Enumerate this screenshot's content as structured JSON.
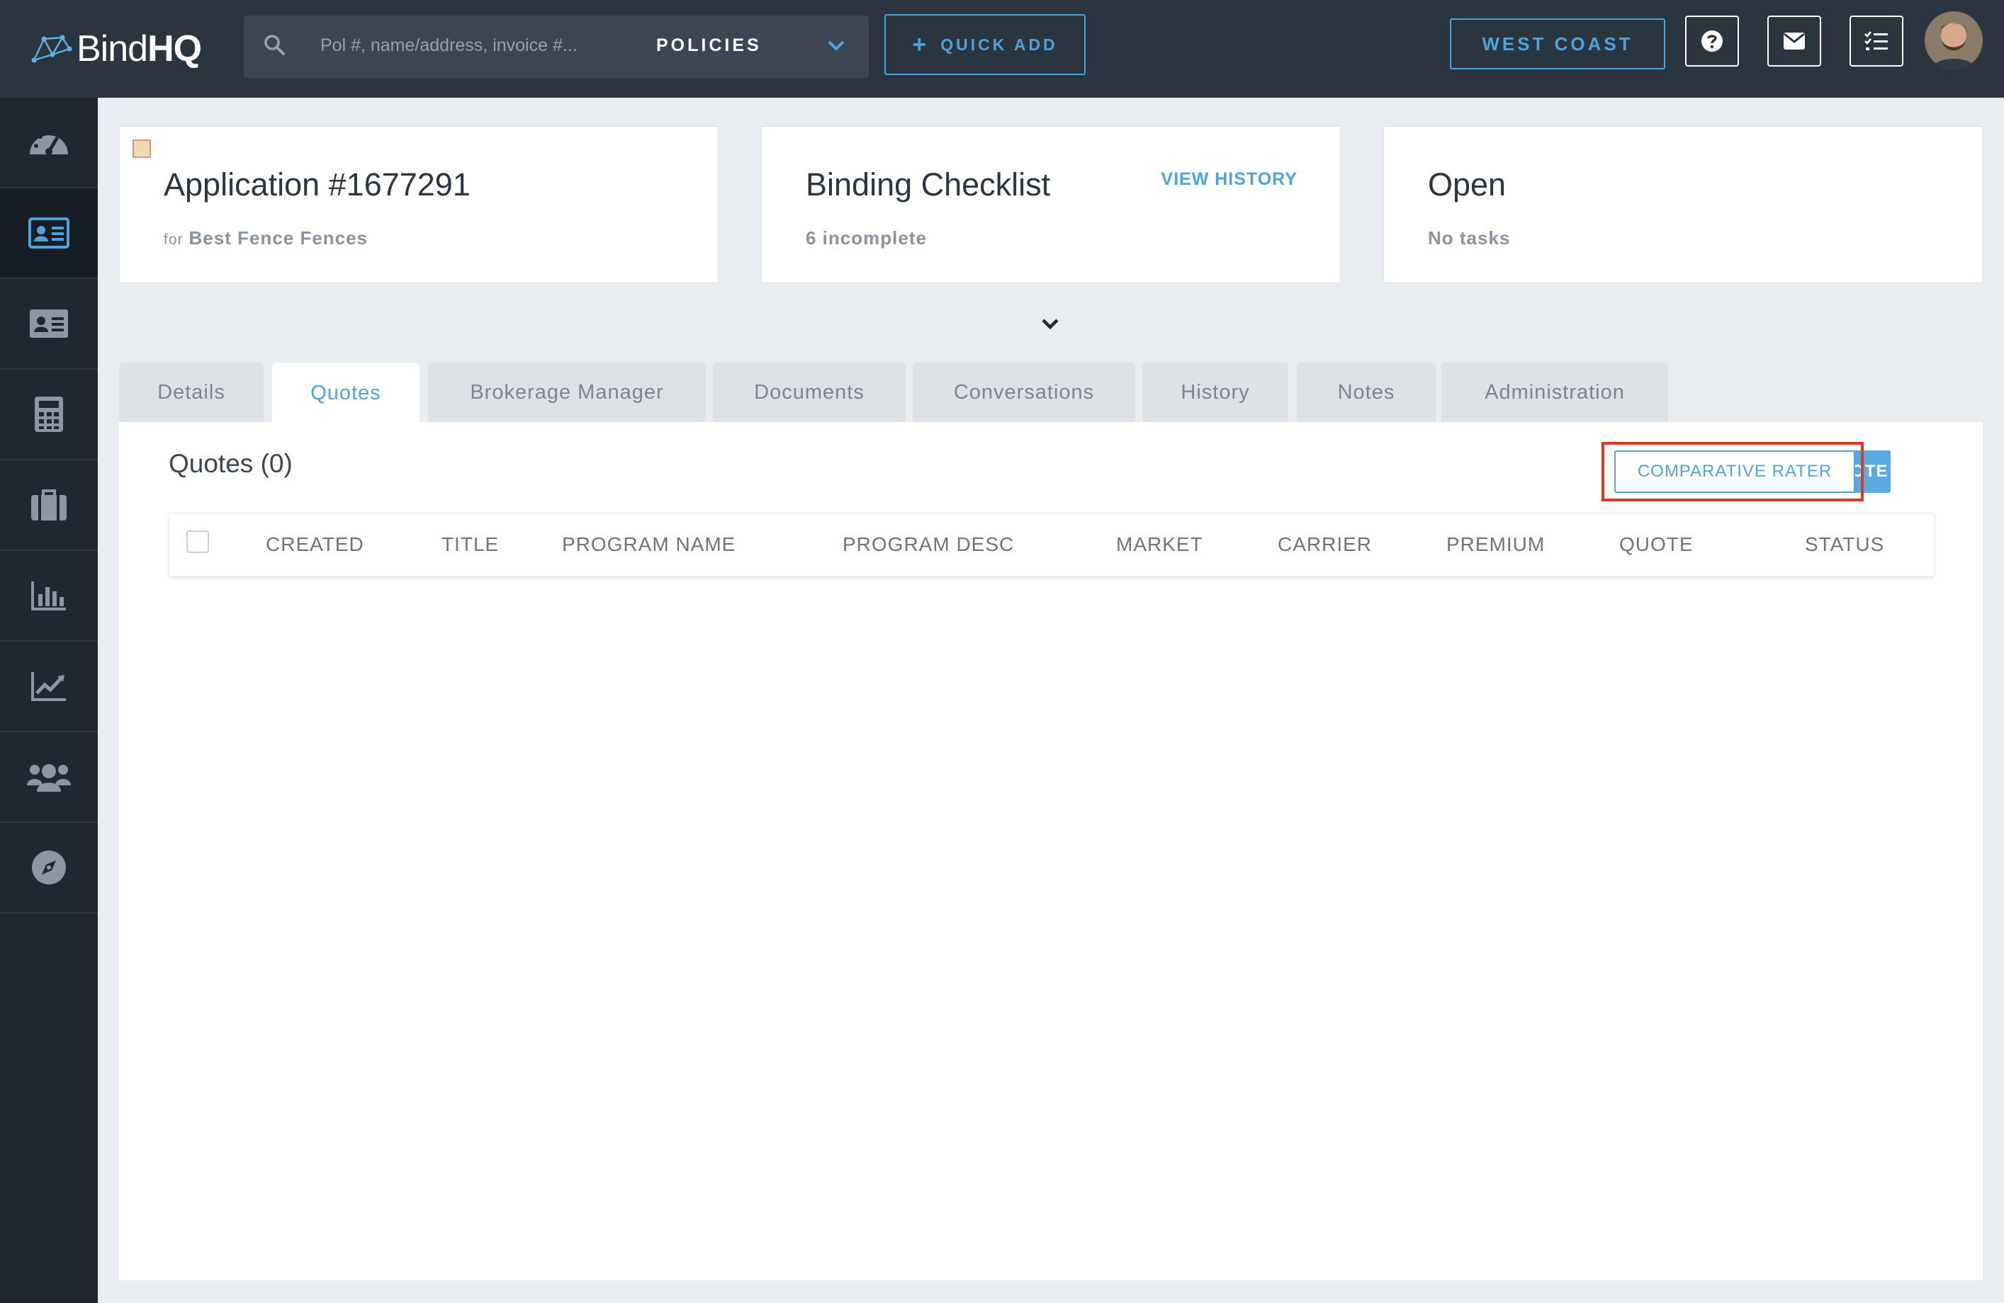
{
  "brand": {
    "logo_text_bind": "Bind",
    "logo_text_hq": "HQ"
  },
  "search": {
    "placeholder": "Pol #, name/address, invoice #...",
    "scope": "POLICIES"
  },
  "topbar": {
    "quick_add_label": "QUICK ADD",
    "region_label": "WEST COAST"
  },
  "cards": {
    "application": {
      "title": "Application #1677291",
      "for_label": "for",
      "insured": "Best Fence Fences"
    },
    "checklist": {
      "title": "Binding Checklist",
      "status": "6 incomplete",
      "link": "VIEW HISTORY"
    },
    "tasks": {
      "title": "Open",
      "status": "No tasks"
    }
  },
  "tabs": [
    {
      "label": "Details"
    },
    {
      "label": "Quotes"
    },
    {
      "label": "Brokerage Manager"
    },
    {
      "label": "Documents"
    },
    {
      "label": "Conversations"
    },
    {
      "label": "History"
    },
    {
      "label": "Notes"
    },
    {
      "label": "Administration"
    }
  ],
  "active_tab": "Quotes",
  "quotes": {
    "title": "Quotes (0)",
    "comparative_rater_label": "COMPARATIVE RATER",
    "create_quote_label": "CREATE QUOTE",
    "columns": [
      "CREATED",
      "TITLE",
      "PROGRAM NAME",
      "PROGRAM DESC",
      "MARKET",
      "CARRIER",
      "PREMIUM",
      "QUOTE",
      "STATUS"
    ],
    "rows": []
  },
  "colors": {
    "topbar_bg": "#2b3540",
    "sidebar_bg": "#1f2730",
    "accent": "#4fa3db",
    "highlight": "#d93a26"
  },
  "sidebar_icons": [
    "dashboard-icon",
    "application-card-icon",
    "contact-card-icon",
    "calculator-icon",
    "briefcase-icon",
    "bar-chart-icon",
    "line-chart-icon",
    "users-icon",
    "compass-icon"
  ]
}
